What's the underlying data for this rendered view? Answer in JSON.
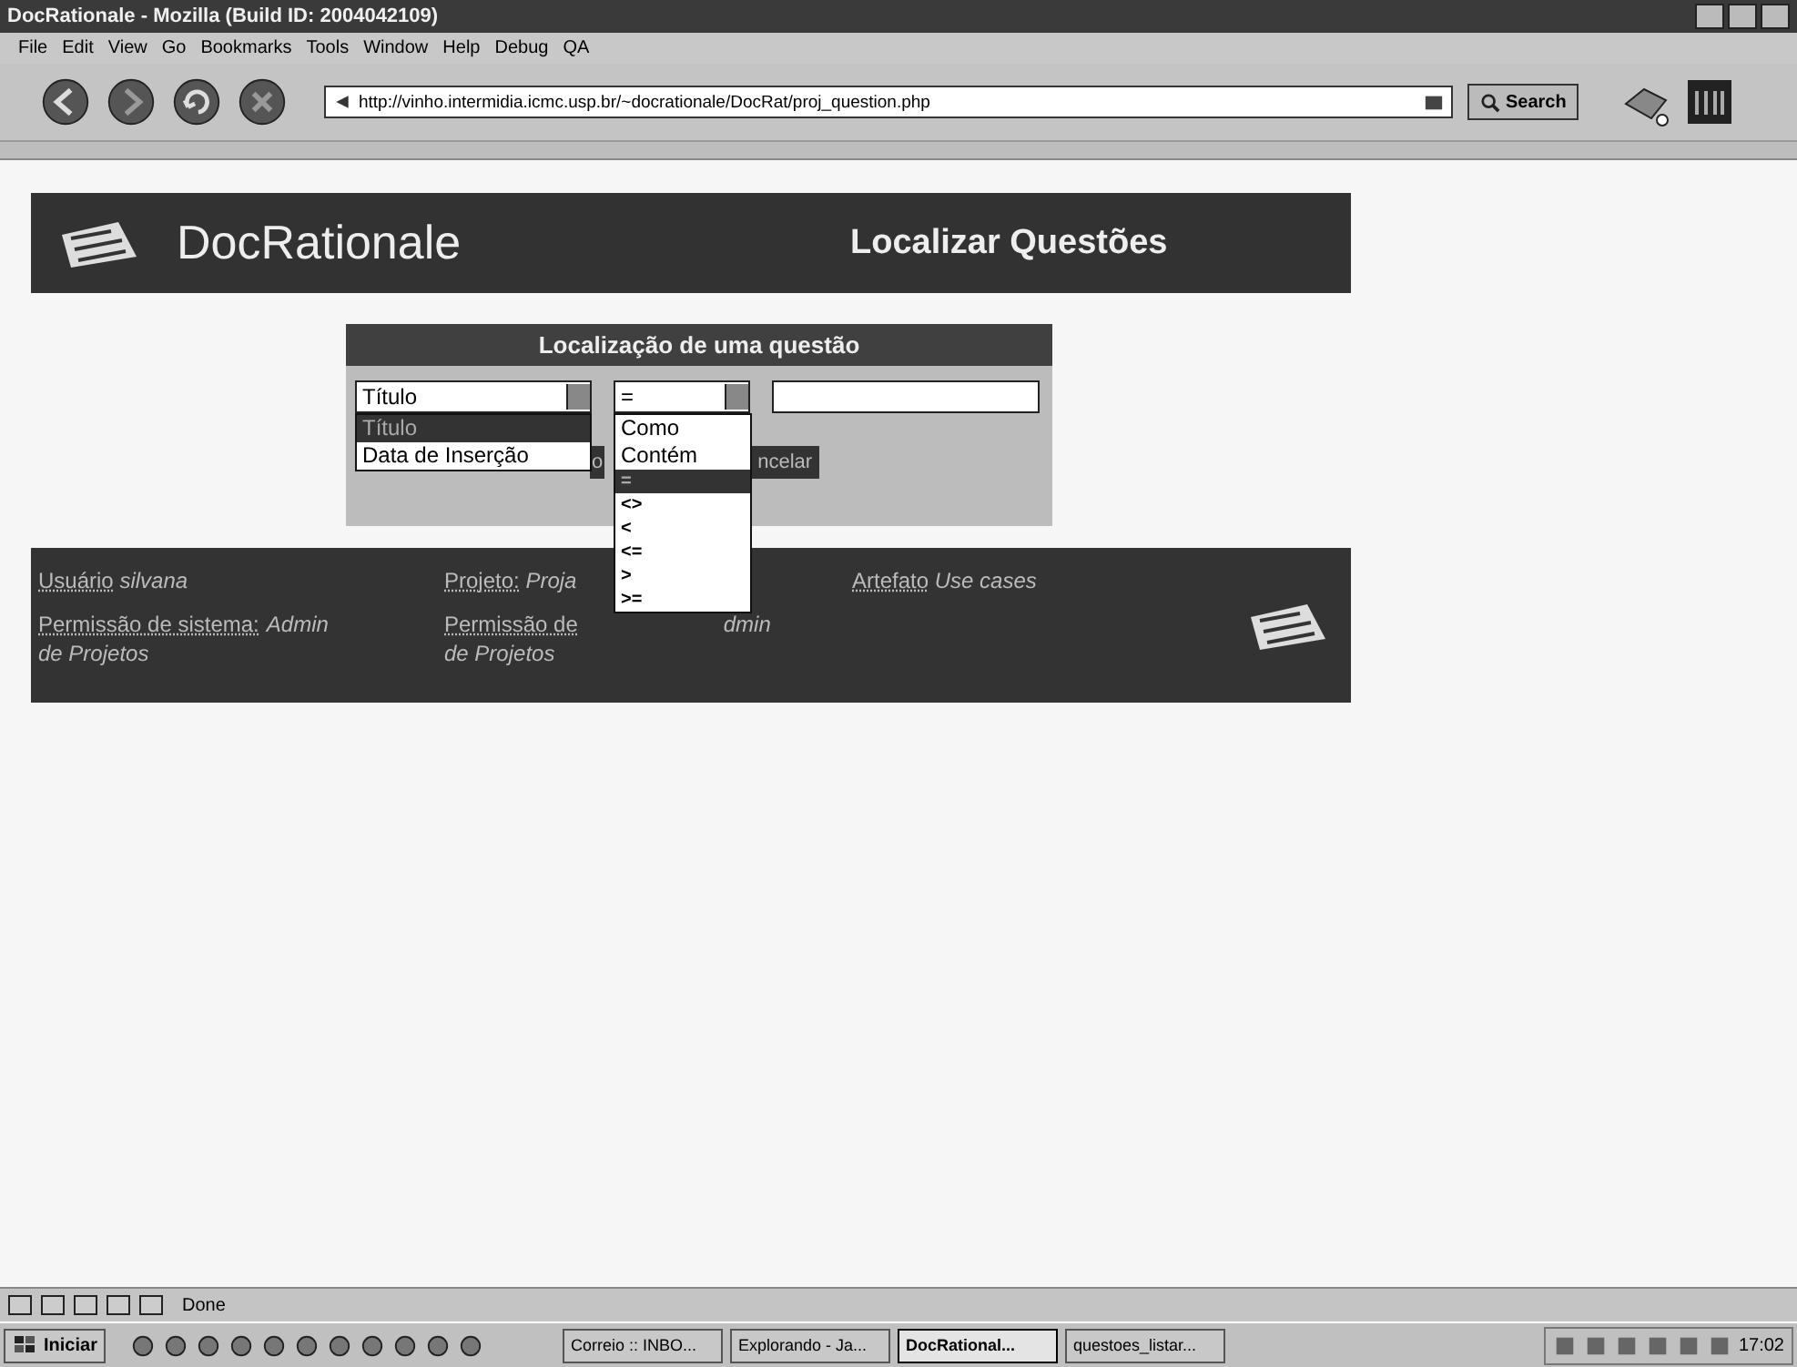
{
  "window": {
    "title": "DocRationale - Mozilla (Build ID: 2004042109)"
  },
  "menu": [
    "File",
    "Edit",
    "View",
    "Go",
    "Bookmarks",
    "Tools",
    "Window",
    "Help",
    "Debug",
    "QA"
  ],
  "toolbar": {
    "url": "http://vinho.intermidia.icmc.usp.br/~docrationale/DocRat/proj_question.php",
    "search_button": "Search"
  },
  "banner": {
    "title": "DocRationale",
    "subtitle": "Localizar Questões"
  },
  "search_form": {
    "title": "Localização de uma questão",
    "field_select": {
      "value": "Título",
      "expanded": true,
      "options": [
        {
          "label": "Título",
          "selected": true
        },
        {
          "label": "Data de Inserção",
          "selected": false
        }
      ]
    },
    "operator_select": {
      "value": "=",
      "expanded": true,
      "options": [
        {
          "label": "Como",
          "selected": false
        },
        {
          "label": "Contém",
          "selected": false
        },
        {
          "label": "=",
          "selected": true
        },
        {
          "label": "<>",
          "selected": false
        },
        {
          "label": "<",
          "selected": false
        },
        {
          "label": "<=",
          "selected": false
        },
        {
          "label": ">",
          "selected": false
        },
        {
          "label": ">=",
          "selected": false
        }
      ]
    },
    "buttons": [
      "o",
      "ncelar"
    ]
  },
  "info": [
    {
      "label": "Usuário",
      "value": "silvana",
      "kind": "plain"
    },
    {
      "label": "Projeto:",
      "value": "Proja",
      "kind": "plain"
    },
    {
      "label": "Artefato",
      "value": "Use cases",
      "kind": "plain"
    },
    {
      "label": "Permissão de sistema:",
      "value": "Admin",
      "rest": "de Projetos",
      "kind": "wrapped"
    },
    {
      "label": "Permissão de",
      "value": "dmin",
      "rest": "de Projetos",
      "kind": "split"
    }
  ],
  "status_bar": {
    "text": "Done"
  },
  "taskbar": {
    "start": "Iniciar",
    "clock": "17:02",
    "tasks": [
      {
        "label": "Correio :: INBO...",
        "selected": false
      },
      {
        "label": "Explorando - Ja...",
        "selected": false
      },
      {
        "label": "DocRational...",
        "selected": true
      },
      {
        "label": "questoes_listar...",
        "selected": false
      }
    ]
  }
}
